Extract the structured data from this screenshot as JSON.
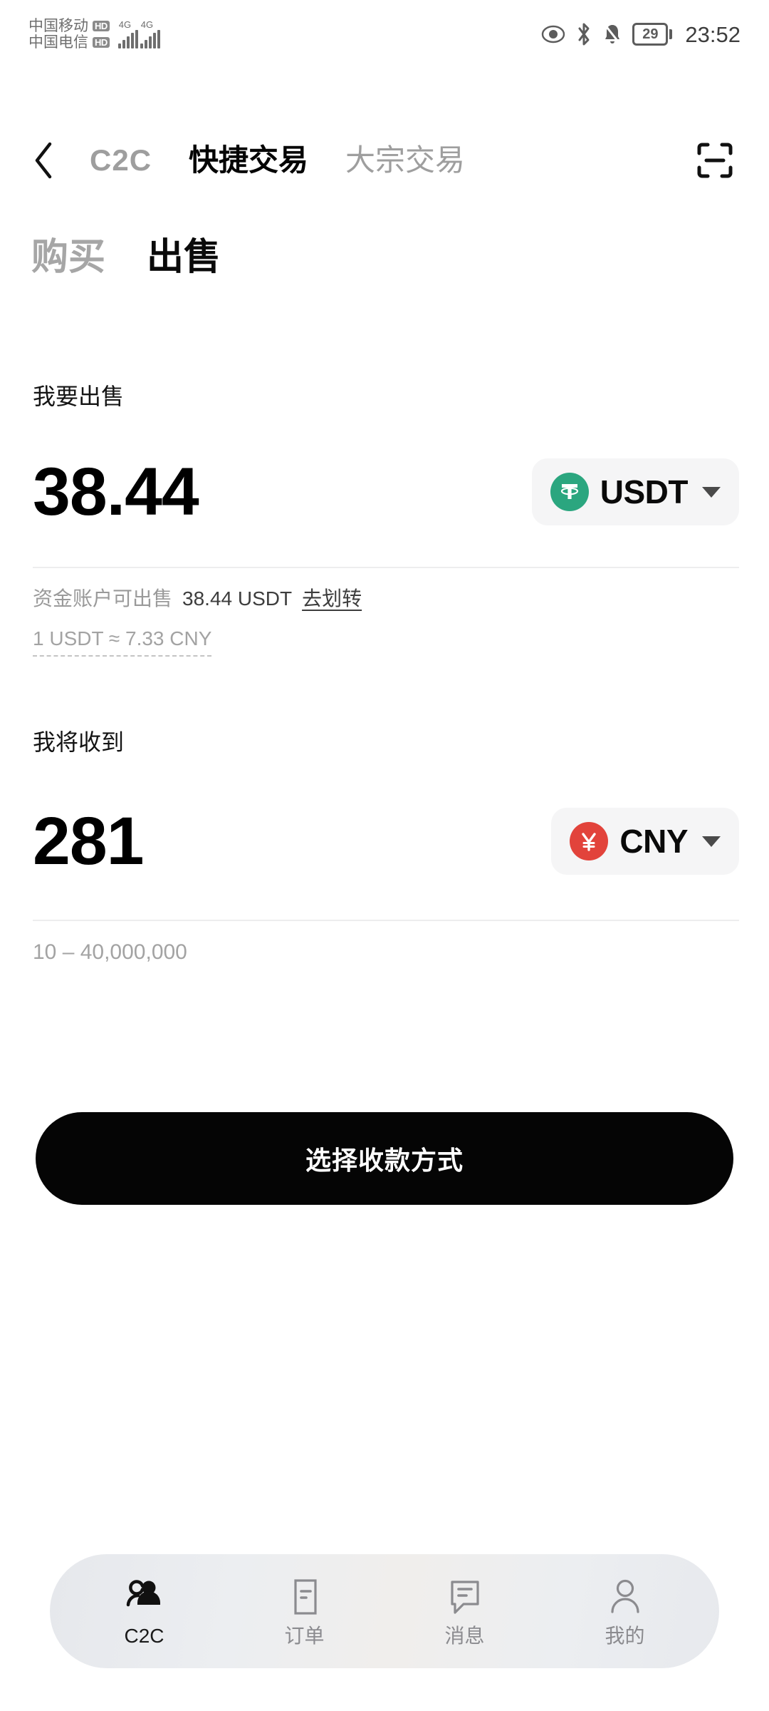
{
  "status_bar": {
    "carriers": [
      {
        "name": "中国移动",
        "badge": "HD",
        "net": "4G"
      },
      {
        "name": "中国电信",
        "badge": "HD",
        "net": "4G"
      }
    ],
    "icons": [
      "eye-icon",
      "bluetooth-icon",
      "bell-muted-icon"
    ],
    "battery_level": "29",
    "time": "23:52"
  },
  "nav": {
    "back_icon": "chevron-left-icon",
    "tabs": [
      {
        "label": "C2C",
        "active": false
      },
      {
        "label": "快捷交易",
        "active": true
      },
      {
        "label": "大宗交易",
        "active": false
      }
    ],
    "scan_icon": "scan-icon"
  },
  "trade_tabs": [
    {
      "label": "购买",
      "active": false
    },
    {
      "label": "出售",
      "active": true
    }
  ],
  "sell": {
    "label": "我要出售",
    "amount": "38.44",
    "currency": {
      "code": "USDT",
      "icon": "tether-icon",
      "color": "#2BA67F"
    },
    "caret_icon": "chevron-down-icon",
    "balance_label": "资金账户可出售",
    "balance_value": "38.44 USDT",
    "transfer_link": "去划转",
    "rate": "1 USDT ≈ 7.33 CNY"
  },
  "receive": {
    "label": "我将收到",
    "amount": "281",
    "currency": {
      "code": "CNY",
      "icon": "yuan-icon",
      "color": "#E2433B"
    },
    "caret_icon": "chevron-down-icon",
    "limit": "10 – 40,000,000"
  },
  "cta": {
    "label": "选择收款方式"
  },
  "bottom_nav": [
    {
      "label": "C2C",
      "icon": "people-icon",
      "active": true
    },
    {
      "label": "订单",
      "icon": "order-document-icon",
      "active": false
    },
    {
      "label": "消息",
      "icon": "chat-bubble-icon",
      "active": false
    },
    {
      "label": "我的",
      "icon": "person-icon",
      "active": false
    }
  ]
}
